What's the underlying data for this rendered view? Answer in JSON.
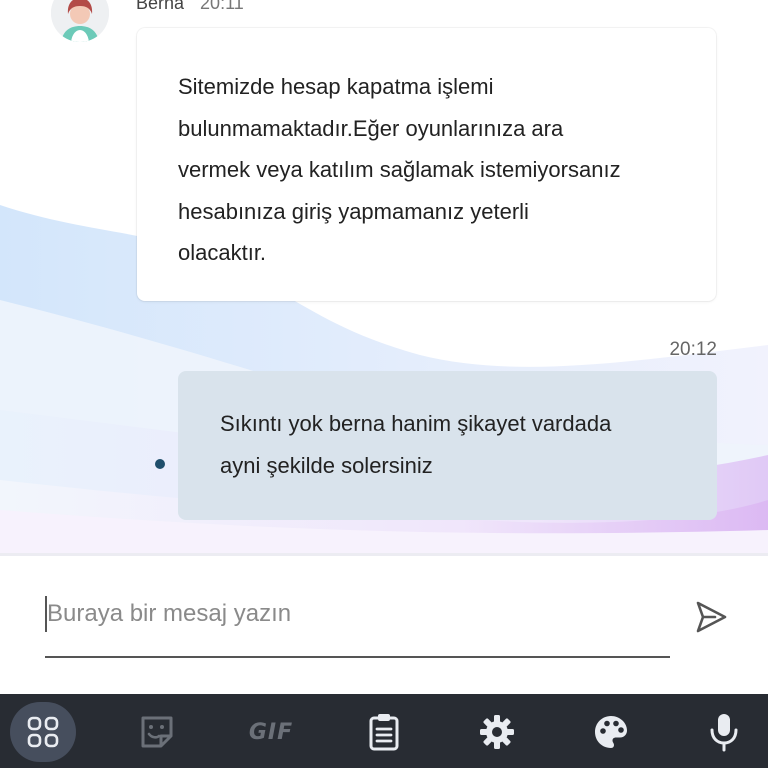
{
  "conversation": {
    "incoming": {
      "sender_name": "Berna",
      "time": "20:11",
      "text": "Sitemizde hesap kapatma işlemi\nbulunmamaktadır.Eğer oyunlarınıza ara\nvermek veya katılım sağlamak istemiyorsanız\nhesabınıza giriş yapmamanız yeterli\nolacaktır."
    },
    "outgoing": {
      "time": "20:12",
      "text": "Sıkıntı yok berna hanim şikayet vardada\nayni şekilde solersiniz"
    }
  },
  "composer": {
    "placeholder": "Buraya bir mesaj yazın",
    "value": ""
  },
  "toolbar": {
    "gif_label": "GIF",
    "items": [
      "apps-icon",
      "sticker-icon",
      "gif-icon",
      "clipboard-icon",
      "gear-icon",
      "palette-icon",
      "microphone-icon"
    ]
  },
  "colors": {
    "toolbar_bg": "#282c33",
    "active_tool_bg": "#464e5d",
    "outgoing_bubble": "#d9e3ec",
    "unread_dot": "#1f4e6b"
  }
}
